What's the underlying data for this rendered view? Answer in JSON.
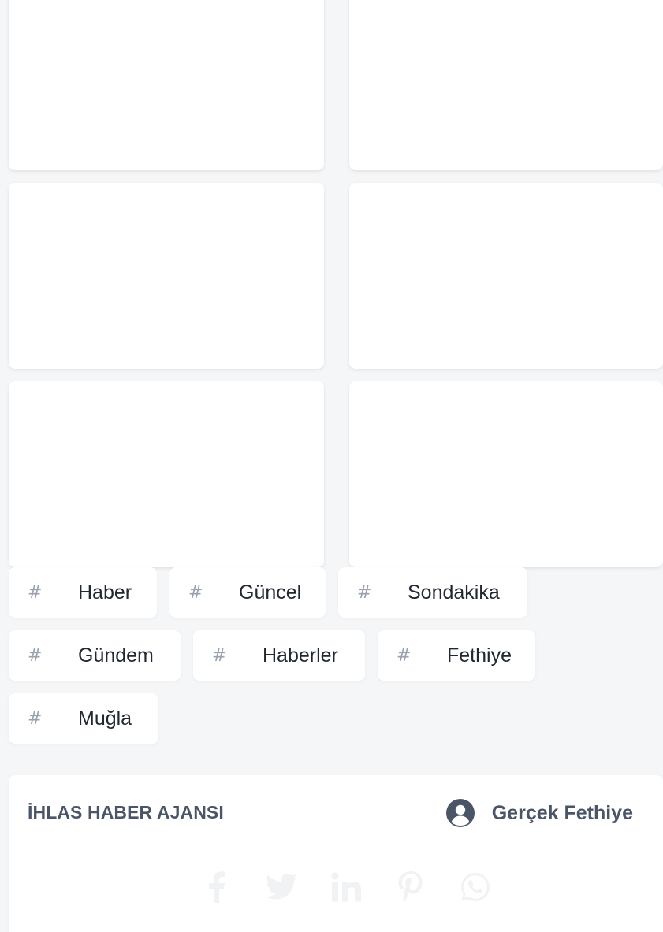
{
  "tags": [
    {
      "hash": "#",
      "label": "Haber"
    },
    {
      "hash": "#",
      "label": "Güncel"
    },
    {
      "hash": "#",
      "label": "Sondakika"
    },
    {
      "hash": "#",
      "label": "Gündem"
    },
    {
      "hash": "#",
      "label": "Haberler"
    },
    {
      "hash": "#",
      "label": "Fethiye"
    },
    {
      "hash": "#",
      "label": "Muğla"
    }
  ],
  "author_box": {
    "agency": "İHLAS HABER AJANSI",
    "author_name": "Gerçek Fethiye",
    "avatar_icon": "user-circle-icon",
    "social_icons": [
      "facebook-icon",
      "twitter-icon",
      "linkedin-icon",
      "pinterest-icon",
      "whatsapp-icon"
    ]
  },
  "colors": {
    "background": "#f5f6f8",
    "card": "#ffffff",
    "tag_text": "#222831",
    "hash": "#9aa2ad",
    "heading": "#4a5568",
    "divider": "#c9d4df",
    "social_icon": "#f1f2f4"
  }
}
